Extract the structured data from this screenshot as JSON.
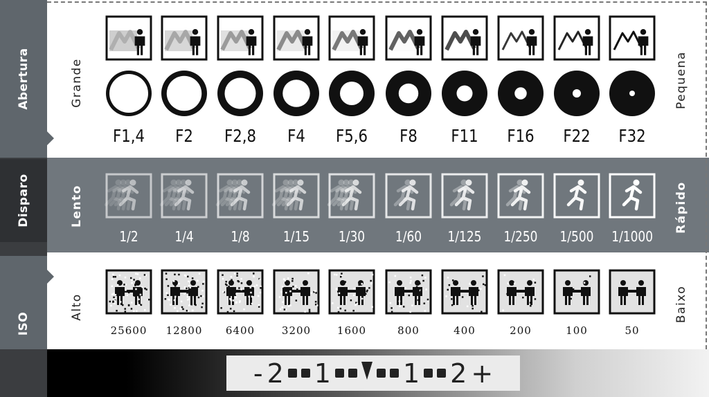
{
  "tabs": {
    "aperture": "Abertura",
    "shutter": "Disparo",
    "iso": "ISO"
  },
  "aperture": {
    "left_label": "Grande",
    "right_label": "Pequena",
    "values": [
      "F1,4",
      "F2",
      "F2,8",
      "F4",
      "F5,6",
      "F8",
      "F11",
      "F16",
      "F22",
      "F32"
    ]
  },
  "shutter": {
    "left_label": "Lento",
    "right_label": "Rápido",
    "values": [
      "1/2",
      "1/4",
      "1/8",
      "1/15",
      "1/30",
      "1/60",
      "1/125",
      "1/250",
      "1/500",
      "1/1000"
    ]
  },
  "iso": {
    "left_label": "Alto",
    "right_label": "Baixo",
    "values": [
      "25600",
      "12800",
      "6400",
      "3200",
      "1600",
      "800",
      "400",
      "200",
      "100",
      "50"
    ]
  },
  "meter": {
    "minus": "-",
    "two_left": "2",
    "one_left": "1",
    "one_right": "1",
    "two_right": "2",
    "plus": "+"
  },
  "colors": {
    "tab_background": "#5f666c",
    "shutter_row_background": "#70777d",
    "left_column_background": "#3b3d40"
  },
  "icons": {
    "aperture_blades": "circle-aperture-icon",
    "depth_of_field": "landscape-person-icon",
    "motion": "running-person-icon",
    "noise": "two-people-handshake-icon"
  }
}
